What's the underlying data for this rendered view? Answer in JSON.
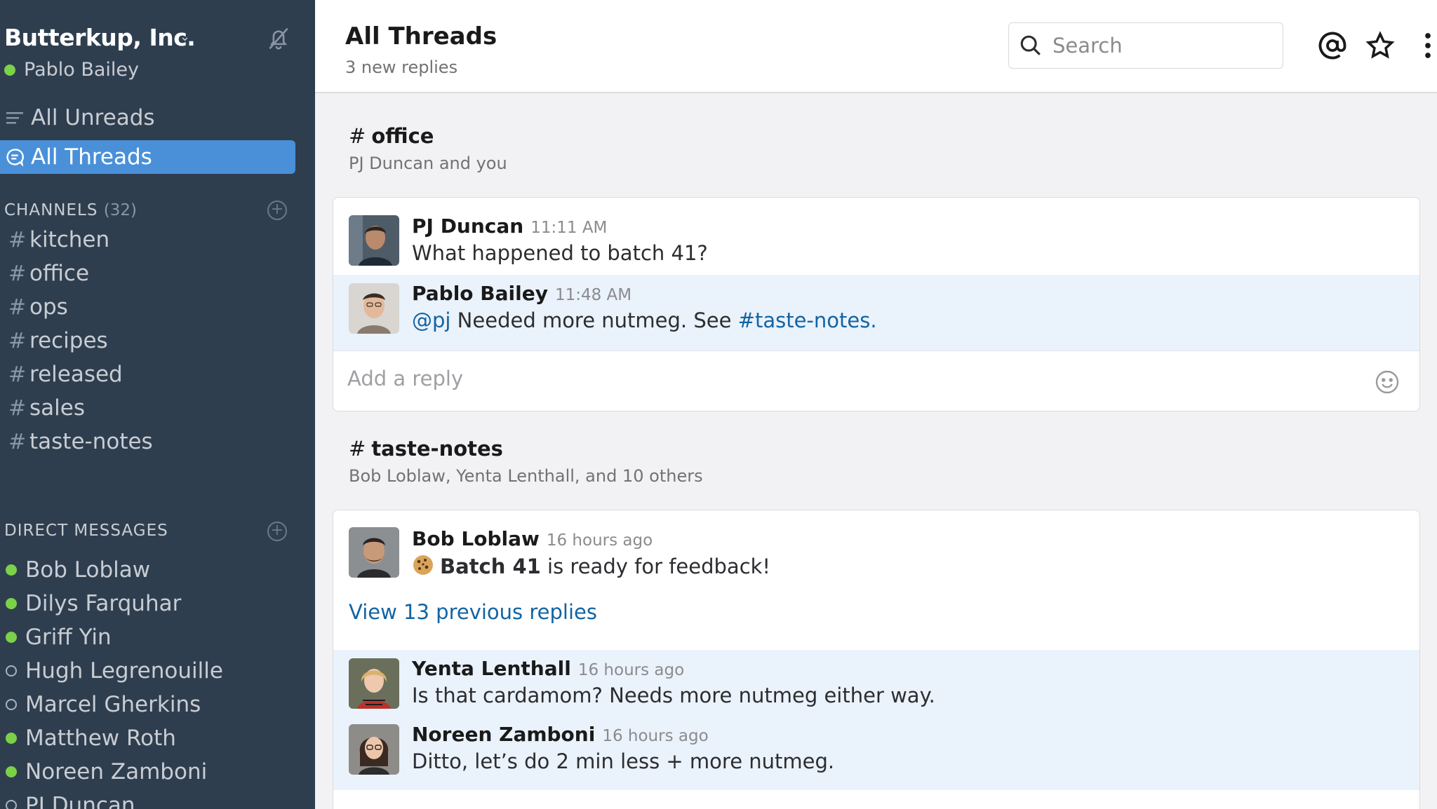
{
  "sidebar": {
    "team_name": "Butterkup, Inc.",
    "user_name": "Pablo Bailey",
    "nav": [
      {
        "label": "All Unreads"
      },
      {
        "label": "All Threads"
      }
    ],
    "channels_label": "CHANNELS",
    "channels_count": "(32)",
    "channels": [
      "kitchen",
      "office",
      "ops",
      "recipes",
      "released",
      "sales",
      "taste-notes"
    ],
    "dm_label": "DIRECT MESSAGES",
    "dms": [
      {
        "name": "Bob Loblaw",
        "status": "online"
      },
      {
        "name": "Dilys Farquhar",
        "status": "online"
      },
      {
        "name": "Griff Yin",
        "status": "online"
      },
      {
        "name": "Hugh Legrenouille",
        "status": "away"
      },
      {
        "name": "Marcel Gherkins",
        "status": "away"
      },
      {
        "name": "Matthew Roth",
        "status": "online"
      },
      {
        "name": "Noreen Zamboni",
        "status": "online"
      },
      {
        "name": "PJ Duncan",
        "status": "away"
      }
    ]
  },
  "header": {
    "title": "All Threads",
    "subtitle": "3 new replies",
    "search_placeholder": "Search"
  },
  "threads": [
    {
      "channel": "office",
      "participants": "PJ Duncan and you",
      "messages": [
        {
          "name": "PJ Duncan",
          "time": "11:11 AM",
          "text": "What happened to batch 41?"
        },
        {
          "name": "Pablo Bailey",
          "time": "11:48 AM",
          "mention": "@pj",
          "text": " Needed more nutmeg. See ",
          "link": "#taste-notes."
        }
      ],
      "reply_placeholder": "Add a reply"
    },
    {
      "channel": "taste-notes",
      "participants": "Bob Loblaw, Yenta Lenthall, and 10 others",
      "messages": [
        {
          "name": "Bob Loblaw",
          "time": "16 hours ago",
          "bold": "Batch 41",
          "text": " is ready for feedback!"
        },
        {
          "name": "Yenta Lenthall",
          "time": "16 hours ago",
          "text": "Is that cardamom? Needs more nutmeg either way."
        },
        {
          "name": "Noreen Zamboni",
          "time": "16 hours ago",
          "text": "Ditto, let’s do 2 min less + more nutmeg."
        }
      ],
      "view_more": "View 13 previous replies"
    }
  ],
  "colors": {
    "sidebar_bg": "#2f3e4f",
    "active_item": "#4a90d9",
    "presence_online": "#7bd148",
    "link": "#1264a3",
    "highlight_row": "#eaf2fb"
  }
}
